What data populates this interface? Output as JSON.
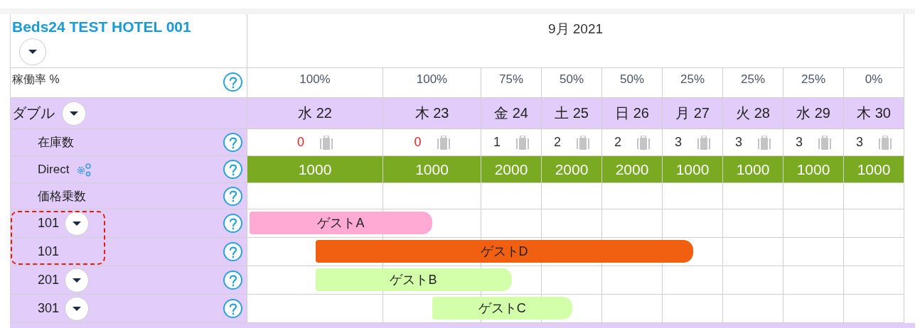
{
  "hotel": {
    "name": "Beds24 TEST HOTEL 001"
  },
  "month": "9月 2021",
  "occupancy": {
    "label": "稼働率 %",
    "values": [
      "100%",
      "100%",
      "75%",
      "50%",
      "50%",
      "25%",
      "25%",
      "25%",
      "0%"
    ]
  },
  "room_type": {
    "name": "ダブル",
    "days": [
      "水 22",
      "木 23",
      "金 24",
      "土 25",
      "日 26",
      "月 27",
      "火 28",
      "水 29",
      "木 30"
    ]
  },
  "rows": [
    {
      "kind": "inventory",
      "label": "在庫数",
      "values": [
        {
          "text": "0",
          "sold_out": true
        },
        {
          "text": "0",
          "sold_out": true
        },
        {
          "text": "1",
          "sold_out": false
        },
        {
          "text": "2",
          "sold_out": false
        },
        {
          "text": "2",
          "sold_out": false
        },
        {
          "text": "3",
          "sold_out": false
        },
        {
          "text": "3",
          "sold_out": false
        },
        {
          "text": "3",
          "sold_out": false
        },
        {
          "text": "3",
          "sold_out": false
        }
      ]
    },
    {
      "kind": "price",
      "label": "Direct",
      "values": [
        "1000",
        "1000",
        "2000",
        "2000",
        "2000",
        "1000",
        "1000",
        "1000",
        "1000"
      ]
    },
    {
      "kind": "blank",
      "label": "価格乗数"
    }
  ],
  "units": [
    {
      "label": "101",
      "menu": true,
      "highlighted": true,
      "bookings": [
        {
          "guest": "ゲストA",
          "continued": true,
          "color": "#ffaad4",
          "cover": [
            true,
            true,
            false,
            false,
            false,
            false,
            false,
            false,
            false
          ]
        }
      ]
    },
    {
      "label": "101",
      "menu": false,
      "highlighted": true,
      "bookings": [
        {
          "guest": "ゲストD",
          "continued": false,
          "color": "#f06010",
          "cover": [
            true,
            true,
            true,
            true,
            true,
            true,
            false,
            false,
            false
          ]
        }
      ]
    },
    {
      "label": "201",
      "menu": true,
      "highlighted": false,
      "bookings": [
        {
          "guest": "ゲストB",
          "continued": false,
          "color": "#d4ffaa",
          "cover": [
            true,
            true,
            true,
            false,
            false,
            false,
            false,
            false,
            false
          ]
        }
      ]
    },
    {
      "label": "301",
      "menu": true,
      "highlighted": false,
      "bookings": [
        {
          "guest": "ゲストC",
          "continued": false,
          "color": "#d4ffaa",
          "cover": [
            false,
            true,
            true,
            true,
            false,
            false,
            false,
            false,
            false
          ]
        }
      ]
    }
  ]
}
